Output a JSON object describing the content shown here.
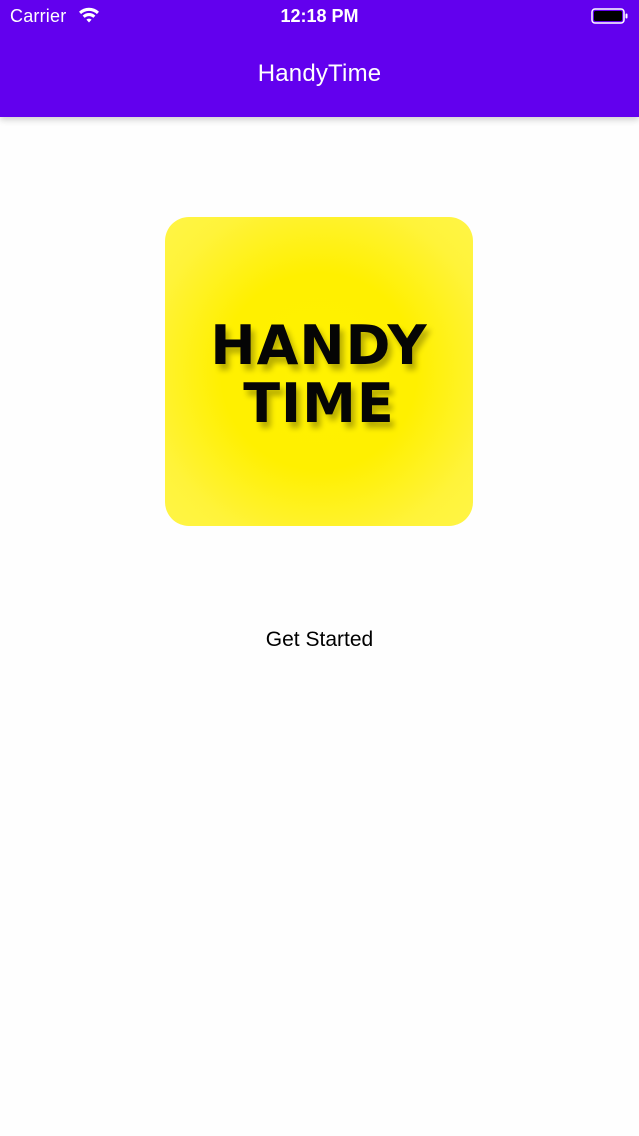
{
  "status_bar": {
    "carrier": "Carrier",
    "time": "12:18 PM",
    "wifi_icon": "wifi-icon",
    "battery_icon": "battery-full-icon"
  },
  "app_bar": {
    "title": "HandyTime",
    "background_color": "#6200ee"
  },
  "logo": {
    "line1": "HANDY",
    "line2": "TIME",
    "background_color": "#fff200"
  },
  "main": {
    "get_started_label": "Get Started"
  }
}
